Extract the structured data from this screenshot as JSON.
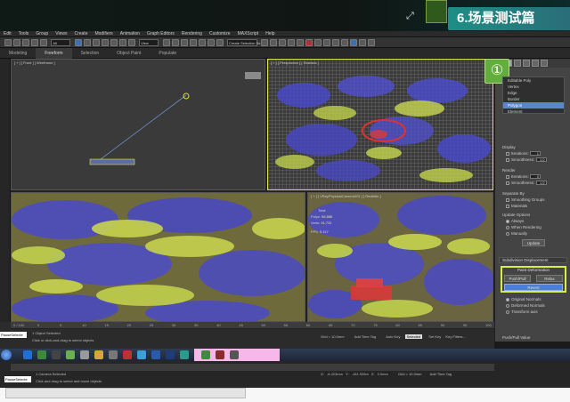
{
  "banner": {
    "title": "6.场景测试篇",
    "expand_icon": "expand-icon"
  },
  "menubar": {
    "items": [
      "Edit",
      "Tools",
      "Group",
      "Views",
      "Create",
      "Modifiers",
      "Animation",
      "Graph Editors",
      "Rendering",
      "Customize",
      "MAXScript",
      "Help"
    ]
  },
  "toolbar": {
    "view_dropdown": "All",
    "coord_dropdown": "View",
    "selection_set": "Create Selection Se"
  },
  "ribbon": {
    "tabs": [
      "Modeling",
      "Freeform",
      "Selection",
      "Object Paint",
      "Populate"
    ],
    "active_index": 1
  },
  "viewports": {
    "front_label": "[ + ] [ Front ] [ Wireframe ]",
    "persp_label": "[ + ] [ Perspective ] [ Realistic ]",
    "camera_label": "[ + ] [ VRayPhysicalCamera001 ] [ Realistic ]",
    "stats": {
      "header": "Total",
      "polys_label": "Polys:",
      "polys_value": "96,886",
      "verts_label": "Verts:",
      "verts_value": "91,731",
      "fps_label": "FPS:",
      "fps_value": "5.117"
    }
  },
  "command_panel": {
    "badge": "①",
    "subobject_levels": [
      "Editable Poly",
      "Vertex",
      "Edge",
      "Border",
      "Polygon",
      "Element"
    ],
    "selected_level": "Polygon",
    "display_header": "Display",
    "display_iterations_label": "Iterations:",
    "display_iterations_value": "1",
    "display_smoothness_label": "Smoothness:",
    "display_smoothness_value": "1.0",
    "render_header": "Render",
    "render_iterations_label": "Iterations:",
    "render_iterations_value": "0",
    "render_smoothness_label": "Smoothness:",
    "render_smoothness_value": "1.0",
    "separate_header": "Separate By",
    "smoothing_groups": "Smoothing Groups",
    "materials": "Materials",
    "update_header": "Update Options",
    "always": "Always",
    "when_rendering": "When Rendering",
    "manually": "Manually",
    "update_button": "Update",
    "subdivision_rollout": "Subdivision Displacement",
    "paint_deformation": "Paint Deformation",
    "push_pull": "Push/Pull",
    "relax": "Relax",
    "revert": "Revert",
    "original_normals": "Original Normals",
    "deformed_normals": "Deformed Normals",
    "transform_axis": "Transform axis",
    "push_pull_value_label": "Push/Pull Value"
  },
  "timeline": {
    "ticks": [
      "0",
      "5",
      "10",
      "15",
      "20",
      "25",
      "30",
      "35",
      "40",
      "45",
      "50",
      "55",
      "60",
      "65",
      "70",
      "75",
      "80",
      "85",
      "90",
      "95",
      "100"
    ],
    "frame_counter": "0 / 100"
  },
  "status": {
    "prompt_text": "PauseSelecte",
    "objects_selected": "1 Object Selected",
    "hint1": "Click or click-and-drag to select objects",
    "grid": "Grid = 10.0mm",
    "add_time_tag": "Add Time Tag",
    "auto_key": "Auto Key",
    "selected": "Selected",
    "set_key": "Set Key",
    "key_filters": "Key Filters..."
  },
  "status2": {
    "prompt_text": "PauseSelecte",
    "camera_selected": "1 Camera Selected",
    "hint2": "Click and drag to select and move objects",
    "x_label": "X:",
    "x_value": "-8.223mm",
    "y_label": "Y:",
    "y_value": "-161.926m",
    "z_label": "Z:",
    "z_value": "0.0mm",
    "grid": "Grid = 10.0mm",
    "add_time_tag": "Add Time Tag"
  }
}
